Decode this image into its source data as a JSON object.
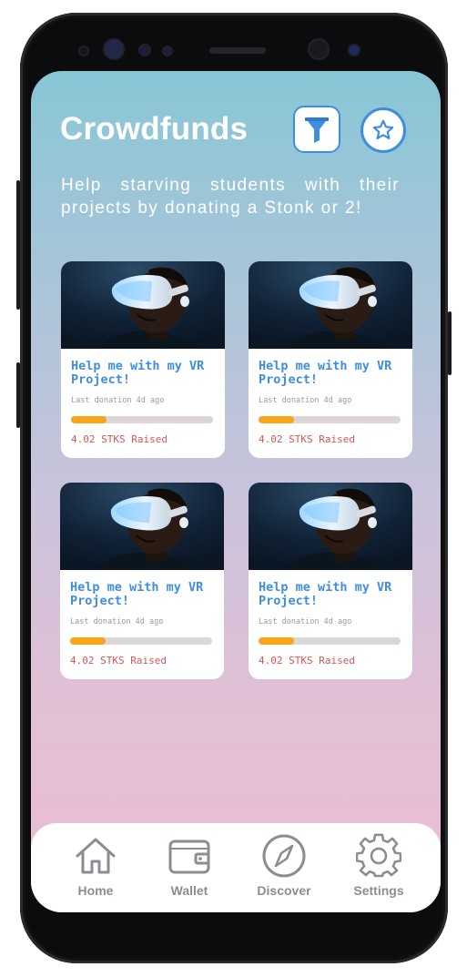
{
  "header": {
    "title": "Crowdfunds",
    "subtitle": "Help starving students with their projects by donating a Stonk or 2!",
    "filter_icon": "filter-icon",
    "favorites_icon": "star-icon"
  },
  "colors": {
    "accent": "#3d8ee0",
    "progress": "#f9a419",
    "raised_text": "#d85555",
    "gradient_top": "#88c6d6",
    "gradient_bottom": "#ecbdd2"
  },
  "cards": [
    {
      "title": "Help me with my VR Project!",
      "meta": "Last donation 4d ago",
      "progress": 0.25,
      "raised": "4.02 STKS Raised",
      "image": "vr-headset-man"
    },
    {
      "title": "Help me with my VR Project!",
      "meta": "Last donation 4d ago",
      "progress": 0.25,
      "raised": "4.02 STKS Raised",
      "image": "vr-headset-man"
    },
    {
      "title": "Help me with my VR Project!",
      "meta": "Last donation 4d ago",
      "progress": 0.25,
      "raised": "4.02 STKS Raised",
      "image": "vr-headset-man"
    },
    {
      "title": "Help me with my VR Project!",
      "meta": "Last donation 4d ago",
      "progress": 0.25,
      "raised": "4.02 STKS Raised",
      "image": "vr-headset-man"
    }
  ],
  "tabbar": {
    "items": [
      {
        "label": "Home",
        "icon": "home-icon"
      },
      {
        "label": "Wallet",
        "icon": "wallet-icon"
      },
      {
        "label": "Discover",
        "icon": "compass-icon"
      },
      {
        "label": "Settings",
        "icon": "gear-icon"
      }
    ]
  }
}
